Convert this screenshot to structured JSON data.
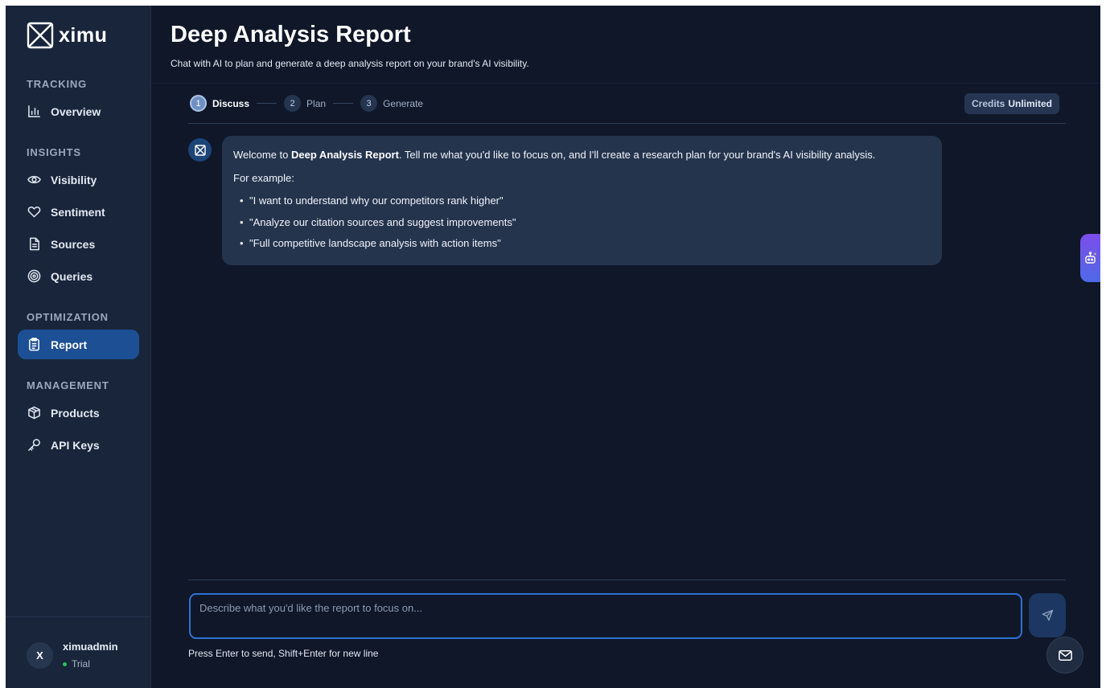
{
  "brand": {
    "name": "ximu",
    "icon": "ximu-logo-icon"
  },
  "sidebar": {
    "sections": [
      {
        "label": "TRACKING",
        "items": [
          {
            "label": "Overview",
            "icon": "bar-chart-icon"
          }
        ]
      },
      {
        "label": "INSIGHTS",
        "items": [
          {
            "label": "Visibility",
            "icon": "eye-icon"
          },
          {
            "label": "Sentiment",
            "icon": "heart-icon"
          },
          {
            "label": "Sources",
            "icon": "document-icon"
          },
          {
            "label": "Queries",
            "icon": "target-icon"
          }
        ]
      },
      {
        "label": "OPTIMIZATION",
        "items": [
          {
            "label": "Report",
            "icon": "clipboard-icon",
            "active": true
          }
        ]
      },
      {
        "label": "MANAGEMENT",
        "items": [
          {
            "label": "Products",
            "icon": "package-icon"
          },
          {
            "label": "API Keys",
            "icon": "key-icon"
          }
        ]
      }
    ]
  },
  "user": {
    "initial": "X",
    "name": "ximuadmin",
    "plan": "Trial",
    "plan_color": "#22c55e"
  },
  "header": {
    "title": "Deep Analysis Report",
    "subtitle": "Chat with AI to plan and generate a deep analysis report on your brand's AI visibility."
  },
  "steps": [
    {
      "num": "1",
      "label": "Discuss",
      "active": true
    },
    {
      "num": "2",
      "label": "Plan",
      "active": false
    },
    {
      "num": "3",
      "label": "Generate",
      "active": false
    }
  ],
  "credits": {
    "label": "Credits",
    "value": "Unlimited"
  },
  "message": {
    "intro_before": "Welcome to ",
    "intro_bold": "Deep Analysis Report",
    "intro_after": ". Tell me what you'd like to focus on, and I'll create a research plan for your brand's AI visibility analysis.",
    "example_label": "For example:",
    "examples": [
      "\"I want to understand why our competitors rank higher\"",
      "\"Analyze our citation sources and suggest improvements\"",
      "\"Full competitive landscape analysis with action items\""
    ]
  },
  "composer": {
    "placeholder": "Describe what you'd like the report to focus on...",
    "hint": "Press Enter to send, Shift+Enter for new line"
  },
  "colors": {
    "accent": "#1d4f95",
    "background": "#0f1729",
    "sidebar": "#19253a",
    "input_border": "#2e73d3"
  }
}
